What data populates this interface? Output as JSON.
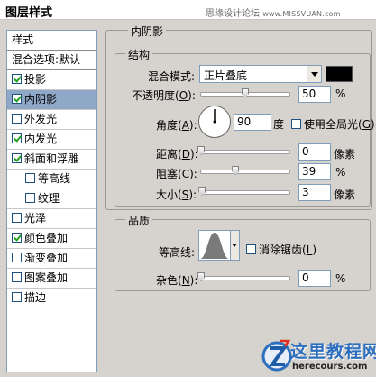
{
  "dialog": {
    "title": "图层样式"
  },
  "watermark": {
    "text": "思缘设计论坛",
    "url": "www.MISSVUAN.com"
  },
  "style_list": {
    "header": "样式",
    "blend_options": "混合选项:默认",
    "items": [
      {
        "label": "投影",
        "checked": true
      },
      {
        "label": "内阴影",
        "checked": true,
        "selected": true
      },
      {
        "label": "外发光",
        "checked": false
      },
      {
        "label": "内发光",
        "checked": true
      },
      {
        "label": "斜面和浮雕",
        "checked": true
      },
      {
        "label": "等高线",
        "checked": false,
        "indent": true
      },
      {
        "label": "纹理",
        "checked": false,
        "indent": true
      },
      {
        "label": "光泽",
        "checked": false
      },
      {
        "label": "颜色叠加",
        "checked": true
      },
      {
        "label": "渐变叠加",
        "checked": false
      },
      {
        "label": "图案叠加",
        "checked": false
      },
      {
        "label": "描边",
        "checked": false
      }
    ]
  },
  "inner_shadow": {
    "group_title": "内阴影",
    "structure": {
      "title": "结构",
      "blend_mode_label": "混合模式:",
      "blend_mode_value": "正片叠底",
      "blend_color": "#000000",
      "opacity_label": "不透明度(O):",
      "opacity_value": "50",
      "opacity_level": 50,
      "opacity_unit": "%",
      "angle_label": "角度(A):",
      "angle_value": "90",
      "angle_unit": "度",
      "global_light_label": "使用全局光(G)",
      "global_light_checked": false,
      "distance_label": "距离(D):",
      "distance_value": "0",
      "distance_level": 0,
      "distance_unit": "像素",
      "choke_label": "阻塞(C):",
      "choke_value": "39",
      "choke_level": 39,
      "choke_unit": "%",
      "size_label": "大小(S):",
      "size_value": "3",
      "size_level": 1.2,
      "size_unit": "像素"
    },
    "quality": {
      "title": "品质",
      "contour_label": "等高线:",
      "anti_alias_label": "消除锯齿(L)",
      "anti_alias_checked": false,
      "noise_label": "杂色(N):",
      "noise_value": "0",
      "noise_level": 0,
      "noise_unit": "%"
    }
  },
  "logo": {
    "name": "这里教程网",
    "url": "herecours.com"
  }
}
